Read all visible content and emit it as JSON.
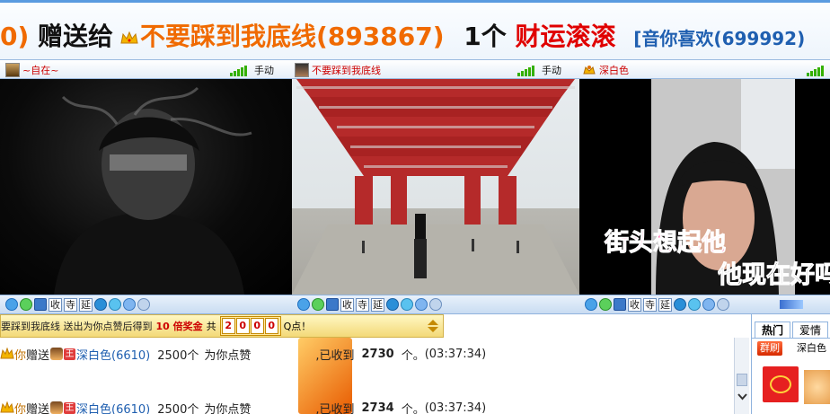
{
  "banner": {
    "lead": "0)",
    "gift_verb": "赠送给",
    "receiver": "不要踩到我底线(893867)",
    "count": "1个",
    "gift_name": "财运滚滚",
    "sender": "[音你喜欢(699992)"
  },
  "userbar": {
    "users": [
      {
        "name": "~自在~",
        "mode": "手动"
      },
      {
        "name": "不要踩到我底线",
        "mode": "手动"
      },
      {
        "name": "深白色"
      }
    ]
  },
  "video3": {
    "caption1": "街头想起他",
    "caption2": "他现在好吗"
  },
  "controls": {
    "btn_shou": "收",
    "btn_si": "寺",
    "btn_yan": "延"
  },
  "announce": {
    "text": "要踩到我底线 送出为你点赞后得到",
    "multiplier": "10 倍奖金",
    "total_label": "共",
    "digits": [
      "2",
      "0",
      "0",
      "0"
    ],
    "unit": "Q点！"
  },
  "chat": {
    "messages": [
      {
        "from": "你",
        "verb": "赠送",
        "to": "深白色(6610)",
        "amount": "2500个",
        "gift": "为你点赞",
        "received_label": ",已收到",
        "received": "2730",
        "unit": "个。",
        "time": "(03:37:34)"
      },
      {
        "from": "你",
        "verb": "赠送",
        "to": "深白色(6610)",
        "amount": "2500个",
        "gift": "为你点赞",
        "received_label": ",已收到",
        "received": "2734",
        "unit": "个。",
        "time": "(03:37:34)"
      }
    ]
  },
  "right_panel": {
    "tabs": [
      "热门",
      "爱情"
    ],
    "badge": "群刷",
    "user": "深白色"
  },
  "colors": {
    "accent_blue": "#1f5fb0",
    "orange": "#f06a00",
    "red": "#e00000",
    "signal_green": "#34b000"
  }
}
